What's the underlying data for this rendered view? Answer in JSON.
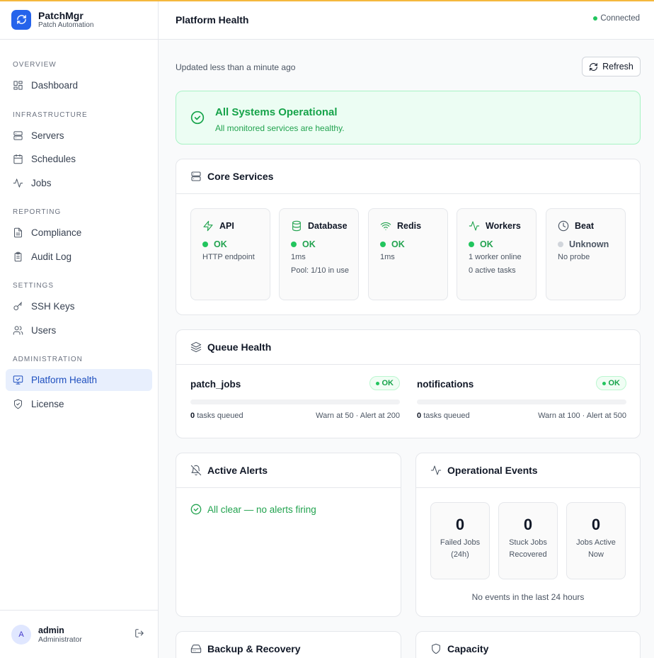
{
  "app": {
    "name": "PatchMgr",
    "subtitle": "Patch Automation"
  },
  "sidebar": {
    "sections": [
      {
        "title": "OVERVIEW"
      },
      {
        "title": "INFRASTRUCTURE"
      },
      {
        "title": "REPORTING"
      },
      {
        "title": "SETTINGS"
      },
      {
        "title": "ADMINISTRATION"
      }
    ],
    "items": [
      {
        "label": "Dashboard",
        "icon": "layout-dashboard-icon"
      },
      {
        "label": "Servers",
        "icon": "server-icon"
      },
      {
        "label": "Schedules",
        "icon": "calendar-icon"
      },
      {
        "label": "Jobs",
        "icon": "activity-icon"
      },
      {
        "label": "Compliance",
        "icon": "file-text-icon"
      },
      {
        "label": "Audit Log",
        "icon": "clipboard-list-icon"
      },
      {
        "label": "SSH Keys",
        "icon": "key-icon"
      },
      {
        "label": "Users",
        "icon": "users-icon"
      },
      {
        "label": "Platform Health",
        "icon": "monitor-check-icon",
        "active": true
      },
      {
        "label": "License",
        "icon": "shield-check-icon"
      }
    ]
  },
  "user": {
    "initial": "A",
    "name": "admin",
    "role": "Administrator"
  },
  "header": {
    "title": "Platform Health",
    "connection": "Connected"
  },
  "toolbar": {
    "updated": "Updated less than a minute ago",
    "refresh_label": "Refresh"
  },
  "overall": {
    "title": "All Systems Operational",
    "subtitle": "All monitored services are healthy."
  },
  "core_services": {
    "title": "Core Services",
    "services": [
      {
        "name": "API",
        "status": "OK",
        "lines": [
          "HTTP endpoint"
        ]
      },
      {
        "name": "Database",
        "status": "OK",
        "lines": [
          "1ms",
          "Pool: 1/10 in use"
        ]
      },
      {
        "name": "Redis",
        "status": "OK",
        "lines": [
          "1ms"
        ]
      },
      {
        "name": "Workers",
        "status": "OK",
        "lines": [
          "1 worker online",
          "0 active tasks"
        ]
      },
      {
        "name": "Beat",
        "status": "Unknown",
        "lines": [
          "No probe"
        ]
      }
    ]
  },
  "queue_health": {
    "title": "Queue Health",
    "queues": [
      {
        "name": "patch_jobs",
        "status": "OK",
        "count": "0",
        "count_label": "tasks queued",
        "thresholds": "Warn at 50 · Alert at 200",
        "fill": 0
      },
      {
        "name": "notifications",
        "status": "OK",
        "count": "0",
        "count_label": "tasks queued",
        "thresholds": "Warn at 100 · Alert at 500",
        "fill": 0
      }
    ]
  },
  "alerts": {
    "title": "Active Alerts",
    "message": "All clear — no alerts firing"
  },
  "events": {
    "title": "Operational Events",
    "stats": [
      {
        "value": "0",
        "label": "Failed Jobs (24h)"
      },
      {
        "value": "0",
        "label": "Stuck Jobs Recovered"
      },
      {
        "value": "0",
        "label": "Jobs Active Now"
      }
    ],
    "footer": "No events in the last 24 hours"
  },
  "backup": {
    "title": "Backup & Recovery"
  },
  "capacity": {
    "title": "Capacity"
  },
  "colors": {
    "accent": "#2563eb",
    "ok": "#22a34f",
    "unknown": "#9ca3af",
    "top_border": "#f5b83d"
  }
}
